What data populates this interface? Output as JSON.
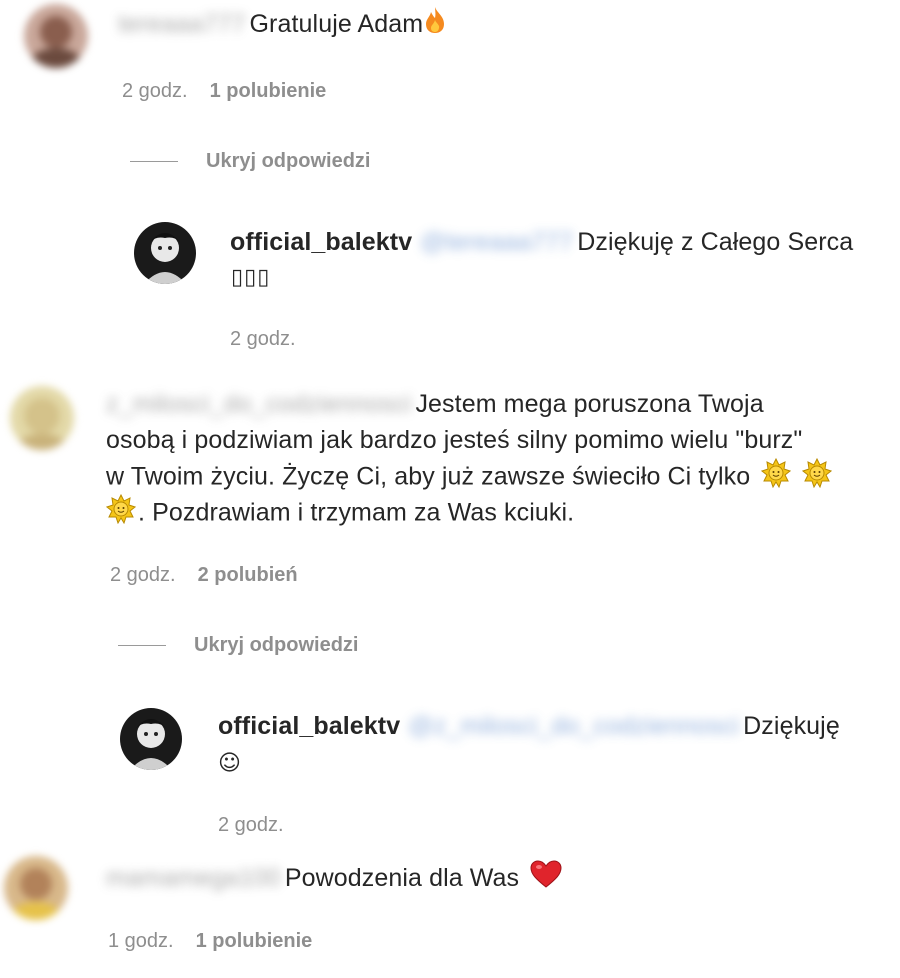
{
  "comments": [
    {
      "username_blurred": "tereaaa777",
      "text": "Gratuluje Adam",
      "emoji": "fire-icon",
      "time": "2 godz.",
      "likes": "1 polubienie",
      "replies_toggle": "Ukryj odpowiedzi",
      "reply": {
        "username": "official_balektv",
        "mention_blurred": "@tereaaa777",
        "text_line1": "Dziękuję z Całego Serca",
        "text_line2": "▯▯▯",
        "time": "2 godz."
      }
    },
    {
      "username_blurred": "z_milosci_do_codziennosci",
      "text_line1": "Jestem mega poruszona Twoja",
      "text_line2": "osobą i podziwiam jak bardzo jesteś silny pomimo wielu \"burz\"",
      "text_line3": "w Twoim życiu. Życzę Ci, aby już zawsze świeciło Ci tylko",
      "text_line4": ". Pozdrawiam i trzymam za Was kciuki.",
      "emoji": "sun-icon",
      "time": "2 godz.",
      "likes": "2 polubień",
      "replies_toggle": "Ukryj odpowiedzi",
      "reply": {
        "username": "official_balektv",
        "mention_blurred": "@z_milosci_do_codziennosci",
        "text_line1": "Dziękuję",
        "text_line2": "☺",
        "time": "2 godz."
      }
    },
    {
      "username_blurred": "mamamega100",
      "text": "Powodzenia dla Was",
      "emoji": "heart-icon",
      "time": "1 godz.",
      "likes": "1 polubienie"
    }
  ],
  "colors": {
    "text": "#262626",
    "meta": "#8e8e8e",
    "mention": "#00376b",
    "heart": "#e0242c",
    "sun": "#f5c518"
  }
}
